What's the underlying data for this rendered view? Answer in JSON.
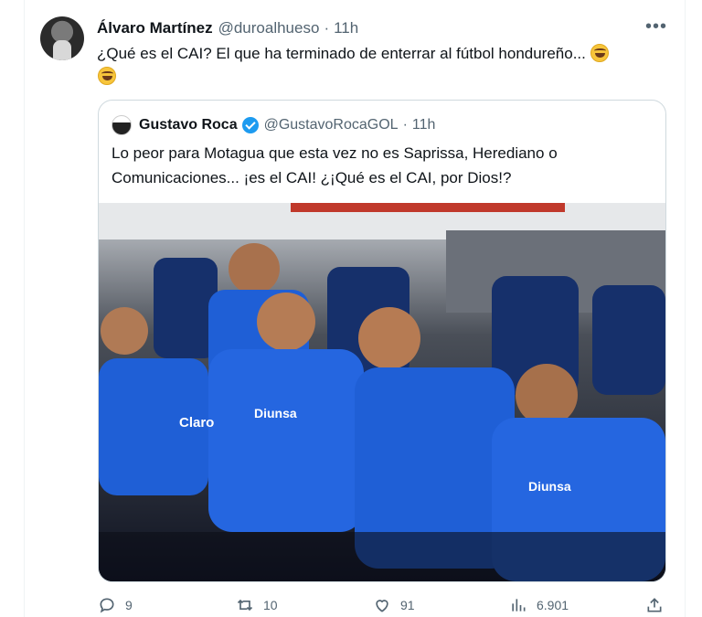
{
  "tweet": {
    "author_name": "Álvaro Martínez",
    "author_handle": "@duroalhueso",
    "separator": "·",
    "time": "11h",
    "more_label": "•••",
    "text": "¿Qué es el CAI? El que ha terminado de enterrar al fútbol hondureño..."
  },
  "quote": {
    "author_name": "Gustavo Roca",
    "author_handle": "@GustavoRocaGOL",
    "separator": "·",
    "time": "11h",
    "text": "Lo peor para Motagua que esta vez no es Saprissa, Herediano o Comunicaciones... ¡es el CAI! ¿¡Qué es el CAI, por Dios!?",
    "photo_labels": {
      "sponsor": "Claro",
      "sponsor2": "Diunsa"
    }
  },
  "actions": {
    "replies": "9",
    "reposts": "10",
    "likes": "91",
    "views": "6.901"
  },
  "colors": {
    "accent": "#1d9bf0",
    "muted": "#536471",
    "jersey": "#1f5fd6"
  },
  "icons": [
    "reply-icon",
    "repost-icon",
    "like-icon",
    "views-icon",
    "share-icon",
    "verified-icon",
    "more-icon",
    "rofl-emoji-icon"
  ]
}
